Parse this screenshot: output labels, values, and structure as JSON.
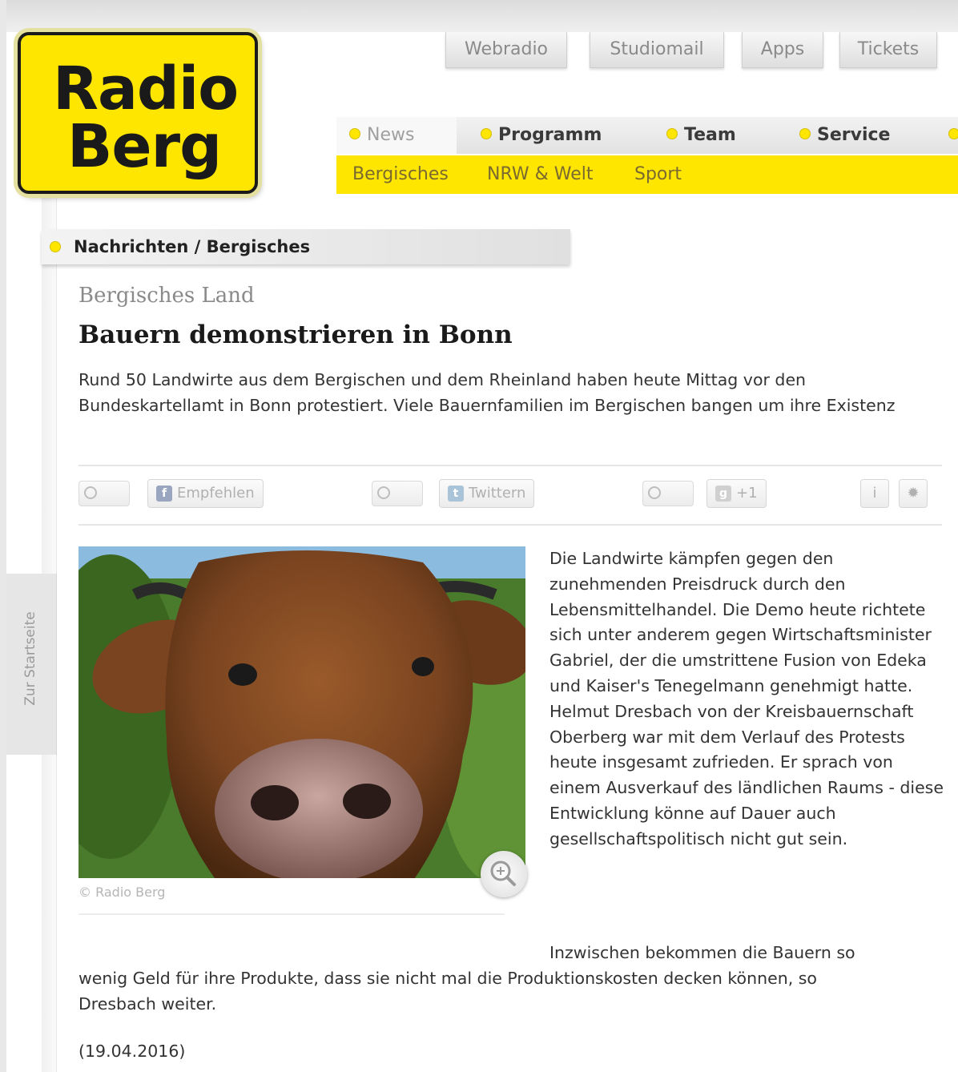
{
  "logo": {
    "line1": "Radio",
    "line2": "Berg"
  },
  "top_tabs": [
    "Webradio",
    "Studiomail",
    "Apps",
    "Tickets"
  ],
  "main_nav": [
    "News",
    "Programm",
    "Team",
    "Service"
  ],
  "sub_nav": [
    "Bergisches",
    "NRW & Welt",
    "Sport"
  ],
  "breadcrumb": "Nachrichten / Bergisches",
  "side_tab": "Zur Startseite",
  "article": {
    "kicker": "Bergisches Land",
    "headline": "Bauern demonstrieren in Bonn",
    "teaser": "Rund 50 Landwirte aus dem Bergischen und dem Rheinland haben heute Mittag vor den Bundeskartellamt in Bonn protestiert. Viele Bauernfamilien im Bergischen bangen um ihre Existenz",
    "social": {
      "facebook": "Empfehlen",
      "twitter": "Twittern",
      "gplus": "+1"
    },
    "image_credit": "© Radio Berg",
    "body_p1": "Die Landwirte kämpfen gegen den zunehmenden Preisdruck durch den Lebensmittelhandel. Die Demo heute richtete sich unter anderem gegen Wirtschaftsminister Gabriel, der die umstrittene Fusion von Edeka und Kaiser's Tenegelmann genehmigt hatte. Helmut Dresbach von der Kreisbauernschaft Oberberg war mit dem Verlauf des Protests heute insgesamt zufrieden. Er sprach von einem Ausverkauf des ländlichen Raums - diese Entwicklung könne auf Dauer auch gesellschaftspolitisch nicht gut sein.",
    "body_p2_start": "Inzwischen bekommen die Bauern so",
    "body_p2_rest": "wenig Geld für ihre Produkte, dass sie nicht mal die Produktionskosten decken können, so Dresbach weiter.",
    "date": "(19.04.2016)"
  }
}
